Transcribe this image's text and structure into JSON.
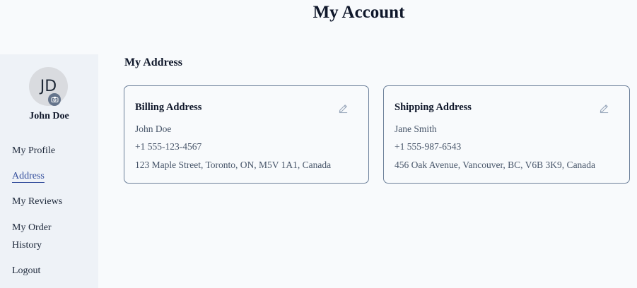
{
  "page": {
    "title": "My Account"
  },
  "sidebar": {
    "avatar_initials": "JD",
    "user_name": "John Doe",
    "items": [
      {
        "label": "My Profile"
      },
      {
        "label": "Address"
      },
      {
        "label": "My Reviews"
      },
      {
        "label": "My Order"
      },
      {
        "label": "History"
      },
      {
        "label": "Logout"
      }
    ],
    "active_item": "Address",
    "icons": {
      "avatar_badge": "camera-icon"
    }
  },
  "main": {
    "section_title": "My Address",
    "cards": [
      {
        "title": "Billing Address",
        "name": "John Doe",
        "phone": "+1 555-123-4567",
        "address": "123 Maple Street, Toronto, ON, M5V 1A1, Canada",
        "icon": "edit-icon"
      },
      {
        "title": "Shipping Address",
        "name": "Jane Smith",
        "phone": "+1 555-987-6543",
        "address": "456 Oak Avenue, Vancouver, BC, V6B 3K9, Canada",
        "icon": "edit-icon"
      }
    ]
  },
  "colors": {
    "background": "#f8fafc",
    "sidebar_background": "#eef2f7",
    "card_border": "#6b7f99",
    "active_link": "#334e9c",
    "muted_text": "#475569"
  }
}
